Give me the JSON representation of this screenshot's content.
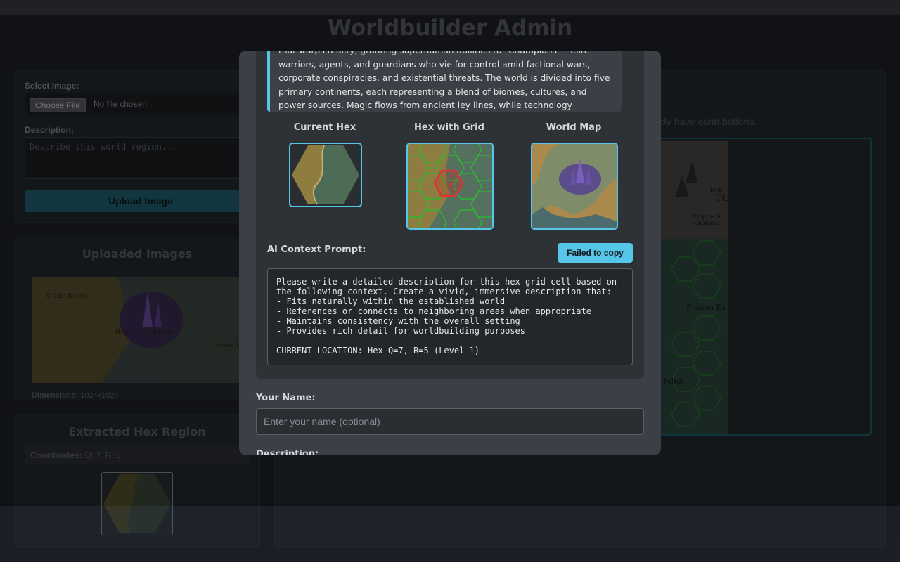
{
  "app": {
    "title": "Worldbuilder Admin"
  },
  "upload": {
    "select_image_label": "Select Image:",
    "choose_file_button": "Choose File",
    "no_file_text": "No file chosen",
    "description_label": "Description:",
    "description_placeholder": "Describe this world region...",
    "upload_button": "Upload Image"
  },
  "uploaded": {
    "title": "Uploaded Images",
    "dimensions_label": "Dimensions:",
    "dimensions_value": "1024x1024",
    "map_labels": [
      "Titans Reach",
      "Radiant Sprawl",
      "Frozen E"
    ]
  },
  "extracted": {
    "title": "Extracted Hex Region",
    "coordinates_label": "Coordinates:",
    "coordinates_value": "Q: 7, R: 5"
  },
  "right_panel": {
    "contributions_text": "dy have contributions.",
    "map_labels": [
      "Empire of Shadows",
      "Frozen Ex",
      "d Isles",
      "TO",
      "Iceh"
    ]
  },
  "modal": {
    "world_description": "that warps reality, granting superhuman abilities to \"Champions\" – elite warriors, agents, and guardians who vie for control amid factional wars, corporate conspiracies, and existential threats. The world is divided into five primary continents, each representing a blend of biomes, cultures, and power sources. Magic flows from ancient ley lines, while technology harnesses radiant energy (a",
    "previews": {
      "current_hex": "Current Hex",
      "hex_with_grid": "Hex with Grid",
      "world_map": "World Map"
    },
    "ai_prompt_label": "AI Context Prompt:",
    "copy_button": "Failed to copy",
    "ai_prompt_text": "Please write a detailed description for this hex grid cell based on\nthe following context. Create a vivid, immersive description that:\n- Fits naturally within the established world\n- References or connects to neighboring areas when appropriate\n- Maintains consistency with the overall setting\n- Provides rich detail for worldbuilding purposes\n\nCURRENT LOCATION: Hex Q=7, R=5 (Level 1)",
    "name_label": "Your Name:",
    "name_placeholder": "Enter your name (optional)",
    "description_label": "Description:"
  }
}
